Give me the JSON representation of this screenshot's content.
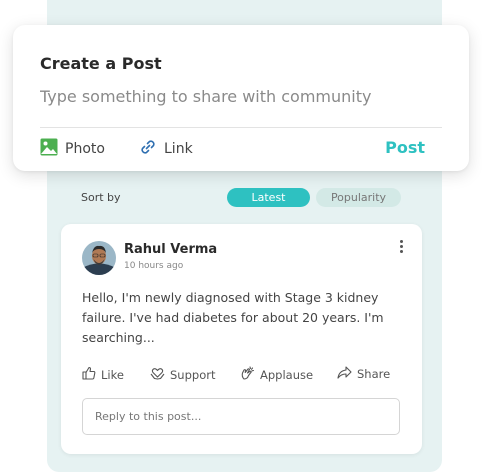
{
  "composer": {
    "title": "Create a Post",
    "placeholder": "Type something to share with community",
    "photo_label": "Photo",
    "link_label": "Link",
    "post_label": "Post"
  },
  "feed": {
    "sort_label": "Sort by",
    "sort_options": [
      "Latest",
      "Popularity"
    ],
    "selected_sort": "Latest"
  },
  "post": {
    "author": "Rahul Verma",
    "time": "10 hours ago",
    "text": "Hello, I'm newly diagnosed with Stage 3 kidney failure. I've had diabetes for about 20 years. I'm searching...",
    "actions": [
      "Like",
      "Support",
      "Applause",
      "Share"
    ],
    "reply_placeholder": "Reply to this post..."
  },
  "colors": {
    "accent": "#2ec1c1",
    "backdrop": "#e6f2f2",
    "inactive_pill": "#d3e9e6"
  },
  "icons": [
    "photo-icon",
    "link-icon",
    "more-vertical-icon",
    "thumbs-up-icon",
    "heart-hands-icon",
    "clapping-hands-icon",
    "share-icon"
  ]
}
